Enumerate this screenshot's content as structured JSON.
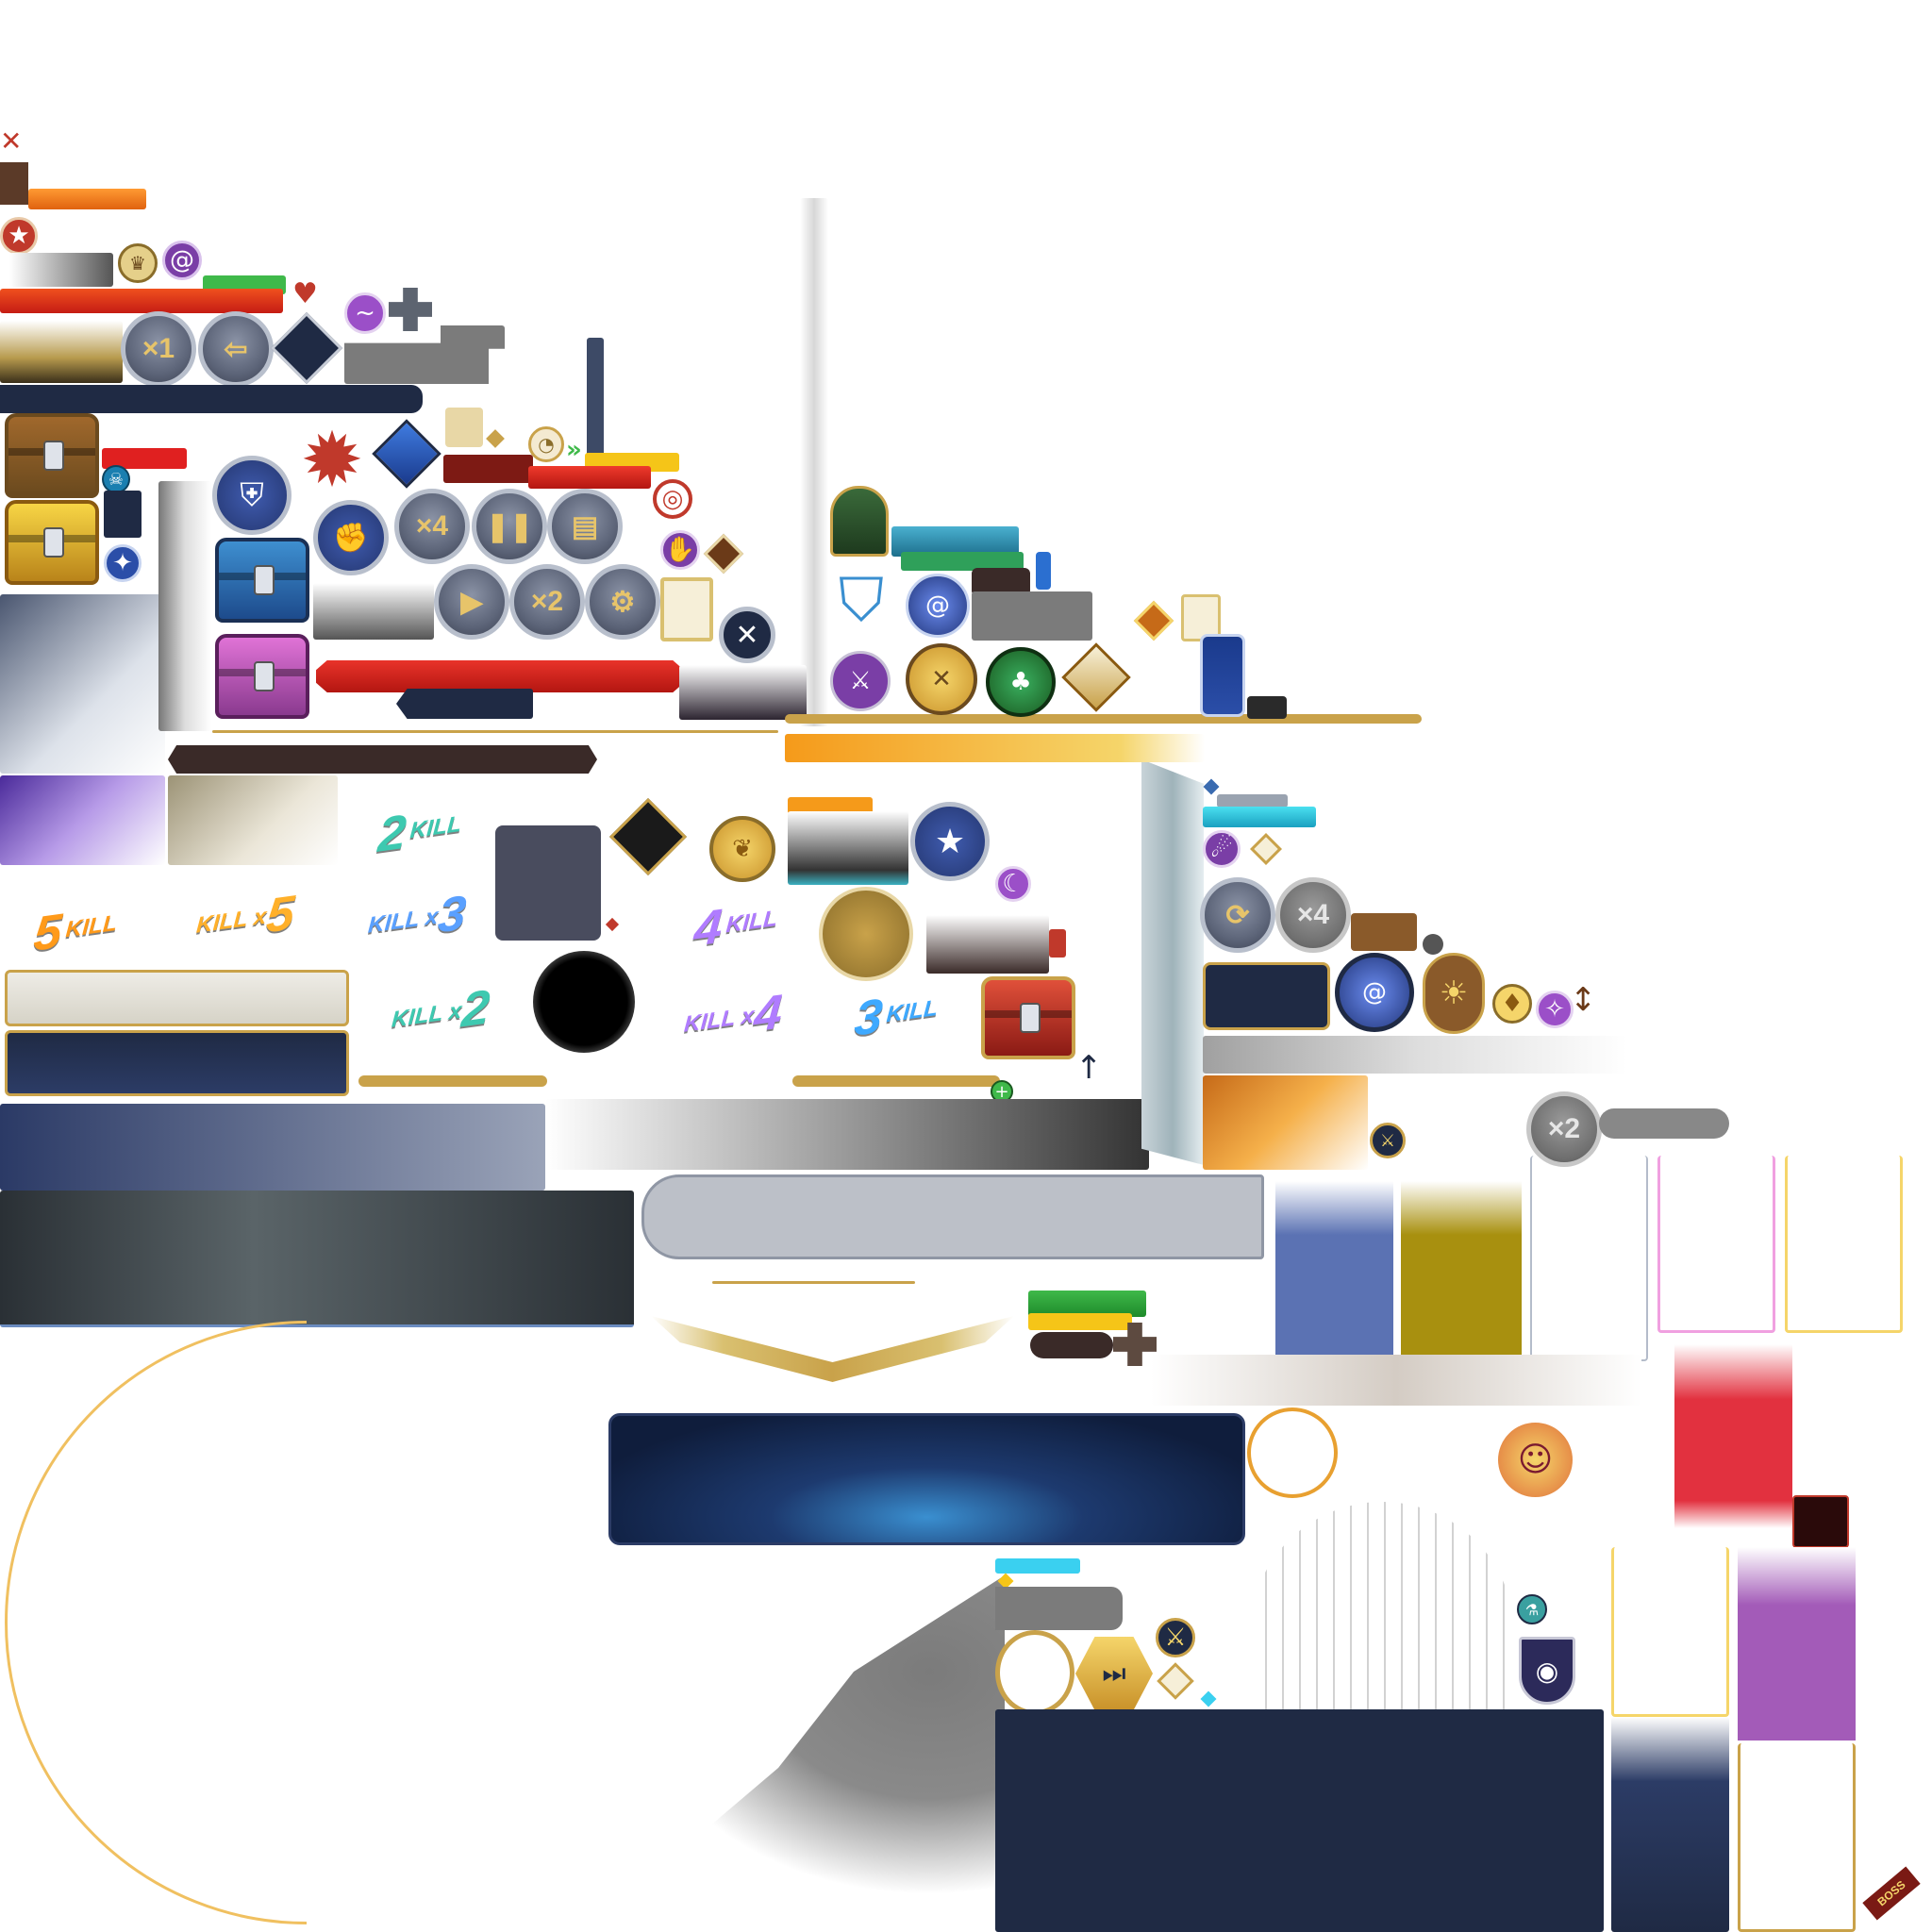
{
  "speed_buttons": {
    "x1": "×1",
    "x4": "×4",
    "x2": "×2",
    "x4_grey": "×4",
    "x2_grey": "×2"
  },
  "kill_banners": {
    "two": {
      "num": "2",
      "label": "KILL"
    },
    "five": {
      "num": "5",
      "label": "KILL"
    },
    "kill_x5": {
      "num": "5",
      "label": "KILL x"
    },
    "kill_x3": {
      "num": "3",
      "label": "KILL x"
    },
    "four": {
      "num": "4",
      "label": "KILL"
    },
    "kill_x2": {
      "num": "2",
      "label": "KILL x"
    },
    "kill_x4": {
      "num": "4",
      "label": "KILL x"
    },
    "three": {
      "num": "3",
      "label": "KILL"
    }
  },
  "boss_tag": "BOSS",
  "colors": {
    "gold": "#c9a24a",
    "navy": "#1f2a44",
    "red_bar": "#d9231e",
    "orange_bar": "#f07a1a",
    "green_bar": "#3fb94a",
    "swatch_blue": "#5b72b3",
    "swatch_olive": "#a8900f",
    "swatch_red": "#e2313f",
    "swatch_purple": "#a35bb8"
  },
  "icons": [
    "crossed-swords-icon",
    "star-badge-icon",
    "gold-crown-icon",
    "purple-swirl-icon",
    "demon-mask-icon",
    "dragon-emblem-icon",
    "exit-icon",
    "diamond-icon",
    "chest-bronze-icon",
    "chest-gold-icon",
    "chest-blue-icon",
    "chest-pink-icon",
    "skull-icon",
    "blue-flame-icon",
    "armor-icon",
    "fist-icon",
    "pause-icon",
    "document-icon",
    "play-icon",
    "gear-icon",
    "spark-star-icon",
    "blue-diamond-icon",
    "target-icon",
    "hand-icon",
    "brown-diamond-icon",
    "card-frame-icon",
    "close-icon",
    "mountain-badge-icon",
    "winged-shield-icon",
    "vortex-icon",
    "sword-crest-icon",
    "crossed-blades-icon",
    "leaf-crest-icon",
    "flame-diamond-icon",
    "potion-scroll-icon",
    "forward-icon",
    "gold-coin-icon",
    "star-ring-icon",
    "wolf-icon",
    "red-chest-icon",
    "refresh-icon",
    "swirl-orb-icon",
    "sun-icon",
    "gold-flame-icon",
    "eye-shield-icon",
    "hexagon-skip-icon",
    "portrait-icon",
    "boss-portrait-icon",
    "colosseum-sketch-icon",
    "plus-icon",
    "arrow-up-icon"
  ]
}
